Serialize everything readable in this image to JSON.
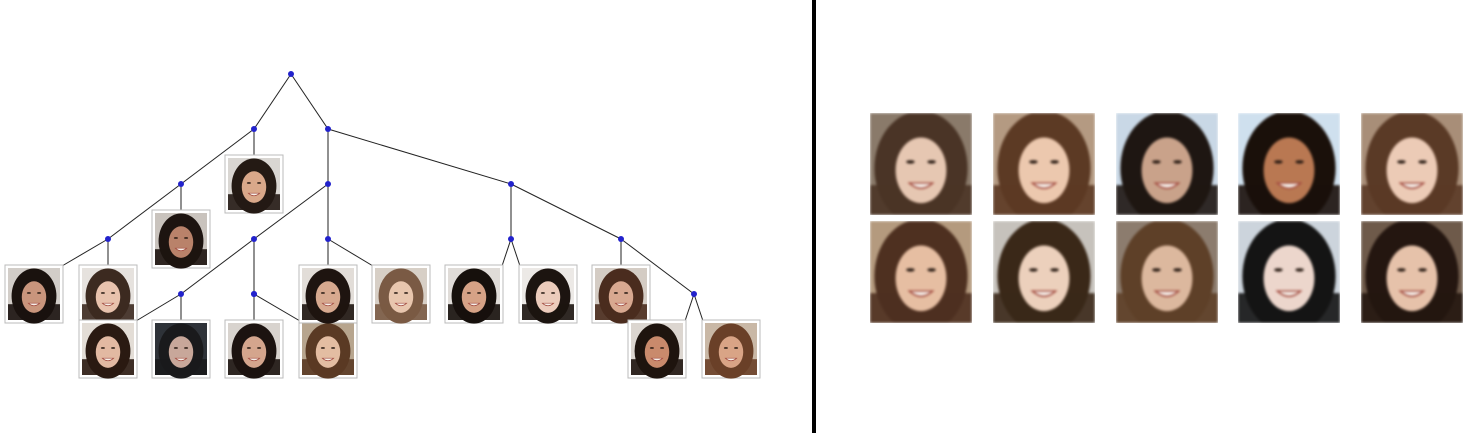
{
  "colors": {
    "node": "#2222cc",
    "edge": "#222222",
    "divider": "#000000",
    "thumb_border": "#bbbbbb"
  },
  "tree": {
    "nodes": [
      "n0",
      "n1",
      "n2",
      "n3",
      "n4",
      "n5",
      "n6",
      "n7",
      "n8",
      "n9",
      "n10",
      "n11",
      "n12",
      "n13",
      "n14"
    ],
    "edges": [
      [
        "n0",
        "n1"
      ],
      [
        "n0",
        "n2"
      ],
      [
        "n1",
        "n3"
      ],
      [
        "n1",
        "leaf-1"
      ],
      [
        "n3",
        "n4"
      ],
      [
        "n3",
        "leaf-2"
      ],
      [
        "n4",
        "leaf-3"
      ],
      [
        "n4",
        "leaf-4"
      ],
      [
        "n2",
        "n5"
      ],
      [
        "n2",
        "n6"
      ],
      [
        "n5",
        "n7"
      ],
      [
        "n5",
        "n8"
      ],
      [
        "n7",
        "n9"
      ],
      [
        "n7",
        "n10"
      ],
      [
        "n7",
        "n11"
      ],
      [
        "n9",
        "leaf-5"
      ],
      [
        "n9",
        "leaf-6"
      ],
      [
        "n10",
        "leaf-7"
      ],
      [
        "n10",
        "leaf-8"
      ],
      [
        "n8",
        "leaf-9"
      ],
      [
        "n8",
        "leaf-10"
      ],
      [
        "n6",
        "n12"
      ],
      [
        "n6",
        "n13"
      ],
      [
        "n12",
        "leaf-11"
      ],
      [
        "n12",
        "leaf-12"
      ],
      [
        "n13",
        "leaf-13"
      ],
      [
        "n13",
        "n14"
      ],
      [
        "n14",
        "leaf-14"
      ],
      [
        "n14",
        "leaf-15"
      ]
    ],
    "leaves": [
      {
        "id": "leaf-1",
        "bg": "#d9d6d2",
        "hair": "#241a14",
        "skin": "#d9a88a"
      },
      {
        "id": "leaf-2",
        "bg": "#c9c3bd",
        "hair": "#1d1410",
        "skin": "#b9826a"
      },
      {
        "id": "leaf-3",
        "bg": "#d2cdc8",
        "hair": "#1a120e",
        "skin": "#c9957c"
      },
      {
        "id": "leaf-4",
        "bg": "#e6e2de",
        "hair": "#3c2a20",
        "skin": "#e8c2ad"
      },
      {
        "id": "leaf-5",
        "bg": "#e3ddd6",
        "hair": "#2a1a12",
        "skin": "#e2b9a2"
      },
      {
        "id": "leaf-6",
        "bg": "#2e3238",
        "hair": "#1a1a1c",
        "skin": "#c8a79a"
      },
      {
        "id": "leaf-7",
        "bg": "#d8d3ce",
        "hair": "#1c1310",
        "skin": "#d4a58d"
      },
      {
        "id": "leaf-8",
        "bg": "#b7a58e",
        "hair": "#5a3a24",
        "skin": "#e3bda2"
      },
      {
        "id": "leaf-9",
        "bg": "#e2ddd8",
        "hair": "#1e1410",
        "skin": "#d7a98f"
      },
      {
        "id": "leaf-10",
        "bg": "#d7cfc6",
        "hair": "#7a5a44",
        "skin": "#e8c6ae"
      },
      {
        "id": "leaf-11",
        "bg": "#e0dcd8",
        "hair": "#16100c",
        "skin": "#d6a286"
      },
      {
        "id": "leaf-12",
        "bg": "#ece9e6",
        "hair": "#1c1410",
        "skin": "#ecccbc"
      },
      {
        "id": "leaf-13",
        "bg": "#d4ccc4",
        "hair": "#4a2c1e",
        "skin": "#d8a890"
      },
      {
        "id": "leaf-14",
        "bg": "#dcd6d0",
        "hair": "#1e140e",
        "skin": "#c98a6c"
      },
      {
        "id": "leaf-15",
        "bg": "#c9b8a6",
        "hair": "#6a4028",
        "skin": "#d9a486"
      }
    ]
  },
  "samples": [
    {
      "id": "sample-1",
      "bg": "#8a7a6a",
      "hair": "#4a3426",
      "skin": "#e6c7b2"
    },
    {
      "id": "sample-2",
      "bg": "#b49a82",
      "hair": "#5c3a24",
      "skin": "#ecc8ae"
    },
    {
      "id": "sample-3",
      "bg": "#c9d8e6",
      "hair": "#1e1612",
      "skin": "#c9a28a"
    },
    {
      "id": "sample-4",
      "bg": "#cfe0ee",
      "hair": "#1a100a",
      "skin": "#b97852"
    },
    {
      "id": "sample-5",
      "bg": "#a88e78",
      "hair": "#5a3a26",
      "skin": "#eccbb6"
    },
    {
      "id": "sample-6",
      "bg": "#b49a7e",
      "hair": "#4e3020",
      "skin": "#e6bea2"
    },
    {
      "id": "sample-7",
      "bg": "#c6c2bc",
      "hair": "#3a2818",
      "skin": "#ecd0bc"
    },
    {
      "id": "sample-8",
      "bg": "#8c7c6e",
      "hair": "#5e4028",
      "skin": "#dcb89e"
    },
    {
      "id": "sample-9",
      "bg": "#ccd4dc",
      "hair": "#141414",
      "skin": "#ecd6cc"
    },
    {
      "id": "sample-10",
      "bg": "#6e5a4a",
      "hair": "#241610",
      "skin": "#e6c2aa"
    }
  ]
}
